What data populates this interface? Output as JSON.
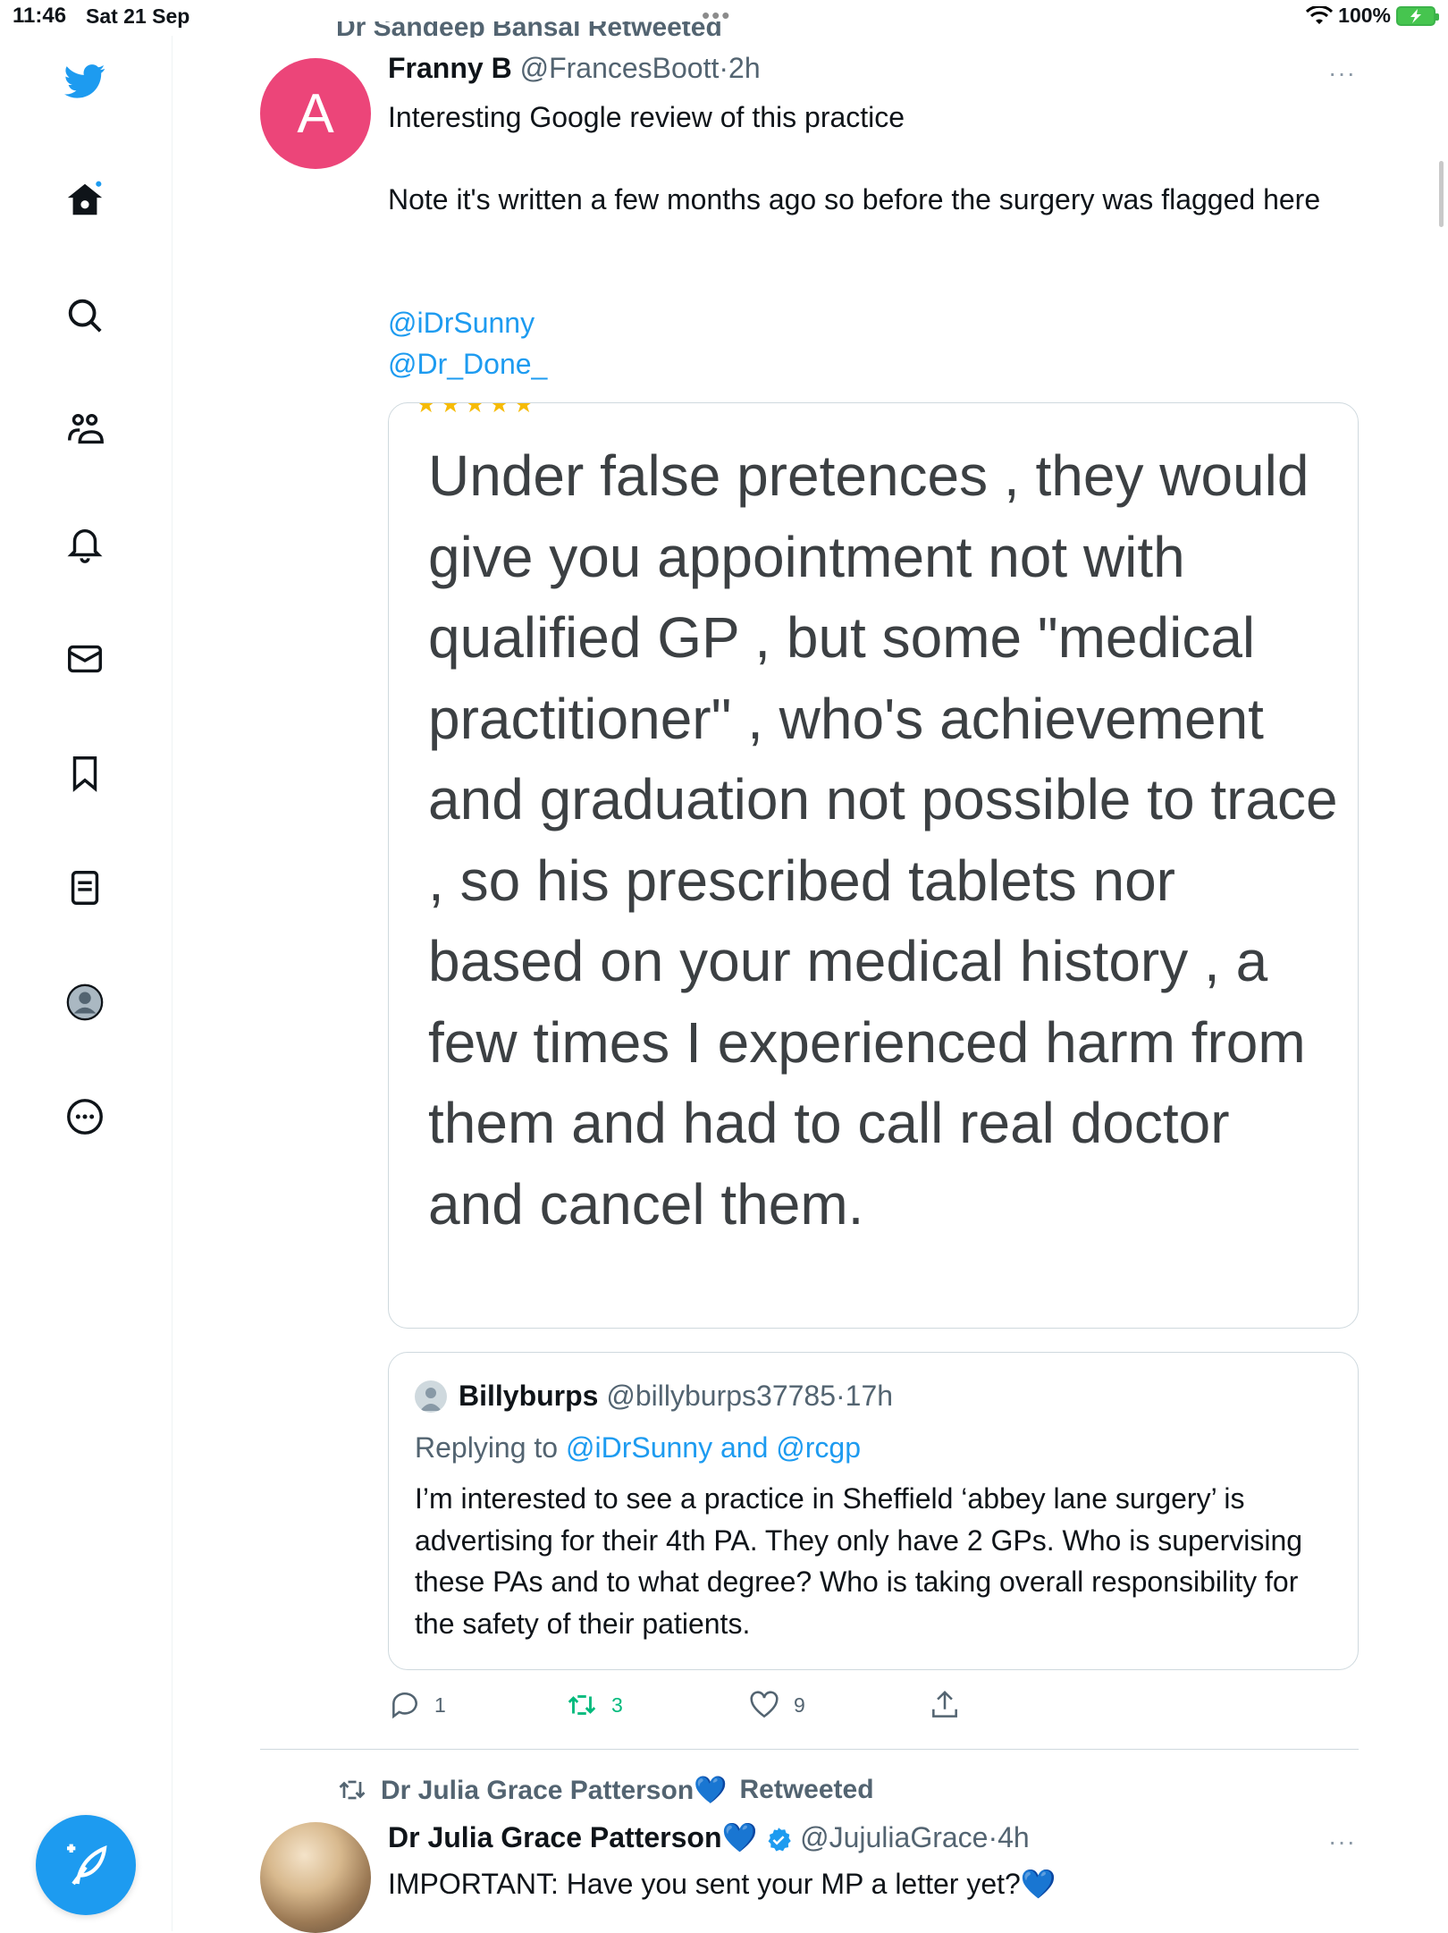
{
  "status_bar": {
    "time": "11:46",
    "date": "Sat 21 Sep",
    "battery": "100%",
    "top_indicator": "•••",
    "battery_color": "#46c54f"
  },
  "sidebar": {
    "items": [
      {
        "name": "twitter-logo-icon"
      },
      {
        "name": "home-icon"
      },
      {
        "name": "search-icon"
      },
      {
        "name": "communities-icon"
      },
      {
        "name": "notifications-icon"
      },
      {
        "name": "messages-icon"
      },
      {
        "name": "bookmarks-icon"
      },
      {
        "name": "lists-icon"
      },
      {
        "name": "profile-icon"
      },
      {
        "name": "more-icon"
      }
    ],
    "compose_icon": "feather-plus-icon",
    "accent_color": "#1d9bf0"
  },
  "timeline": {
    "cut_header": "Dr Sandeep Bansal Retweeted",
    "tweet1": {
      "avatar_letter": "A",
      "avatar_color": "#ec4579",
      "name": "Franny B",
      "handle": "@FrancesBoott",
      "separator": "·",
      "time": "2h",
      "more": "···",
      "line1": "Interesting Google review of this practice",
      "line2": "Note it's written a few months ago so before the surgery was flagged here",
      "mention1": "@iDrSunny",
      "mention2": "@Dr_Done_",
      "media": {
        "stars": "★★★★★",
        "review_text": "Under false pretences , they would give you appointment not with qualified GP , but some \"medical practitioner\" , who's achievement and graduation not possible to trace , so his prescribed tablets nor based on your medical history , a few times I experienced harm from them and had to call real doctor and cancel them."
      },
      "quote": {
        "name": "Billyburps",
        "handle": "@billyburps37785",
        "separator": "·",
        "time": "17h",
        "replying_prefix": "Replying to ",
        "replying_mentions": "@iDrSunny and @rcgp",
        "text": "I’m interested to see a practice in Sheffield ‘abbey lane surgery’ is advertising for their 4th PA. They only have 2 GPs. Who is supervising these PAs and to what degree? Who is taking overall responsibility for the safety of their patients."
      },
      "actions": {
        "replies": "1",
        "retweets": "3",
        "likes": "9"
      }
    },
    "tweet2": {
      "retweeted_by": "Dr Julia Grace Patterson💙",
      "retweeted_label": "Retweeted",
      "name": "Dr Julia Grace Patterson",
      "heart": "💙",
      "handle": "@JujuliaGrace",
      "separator": "·",
      "time": "4h",
      "more": "···",
      "text": "IMPORTANT: Have you sent your MP a letter yet?💙"
    }
  }
}
